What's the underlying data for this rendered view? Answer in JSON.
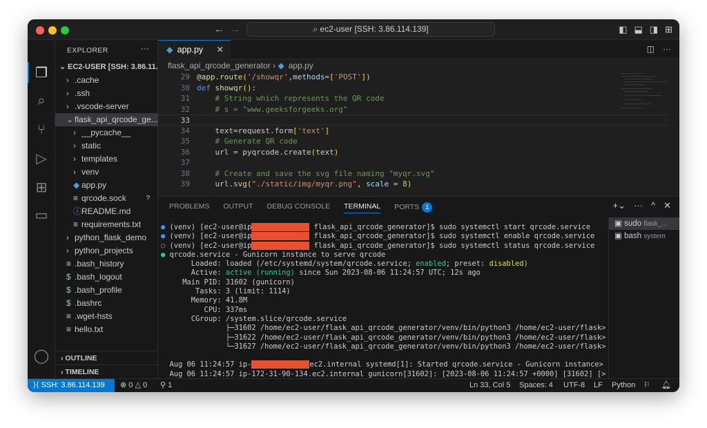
{
  "window": {
    "search": "ec2-user [SSH: 3.86.114.139]"
  },
  "explorer": {
    "title": "EXPLORER",
    "root": "EC2-USER [SSH: 3.86.11...",
    "items": [
      {
        "label": ".cache",
        "chev": "›",
        "indent": 1
      },
      {
        "label": ".ssh",
        "chev": "›",
        "indent": 1
      },
      {
        "label": ".vscode-server",
        "chev": "›",
        "indent": 1
      },
      {
        "label": "flask_api_qrcode_ge...",
        "chev": "⌄",
        "indent": 1,
        "selected": true
      },
      {
        "label": "__pycache__",
        "chev": "›",
        "indent": 2
      },
      {
        "label": "static",
        "chev": "›",
        "indent": 2
      },
      {
        "label": "templates",
        "chev": "›",
        "indent": 2
      },
      {
        "label": "venv",
        "chev": "›",
        "indent": 2
      },
      {
        "label": "app.py",
        "icon": "python",
        "indent": 2
      },
      {
        "label": "qrcode.sock",
        "icon": "file",
        "indent": 2,
        "badge": "?"
      },
      {
        "label": "README.md",
        "icon": "info",
        "indent": 2
      },
      {
        "label": "requirements.txt",
        "icon": "lines",
        "indent": 2
      },
      {
        "label": "python_flask_demo",
        "chev": "›",
        "indent": 1
      },
      {
        "label": "python_projects",
        "chev": "›",
        "indent": 1
      },
      {
        "label": ".bash_history",
        "icon": "lines",
        "indent": 1
      },
      {
        "label": ".bash_logout",
        "icon": "dollar",
        "indent": 1
      },
      {
        "label": ".bash_profile",
        "icon": "dollar",
        "indent": 1
      },
      {
        "label": ".bashrc",
        "icon": "dollar",
        "indent": 1
      },
      {
        "label": ".wget-hsts",
        "icon": "lines",
        "indent": 1
      },
      {
        "label": "hello.txt",
        "icon": "lines",
        "indent": 1
      }
    ],
    "outline": "OUTLINE",
    "timeline": "TIMELINE"
  },
  "editor": {
    "tab": "app.py",
    "breadcrumb": [
      "flask_api_qrcode_generator",
      "app.py"
    ],
    "lines": [
      {
        "n": "29",
        "tokens": [
          [
            "f",
            "@app.route"
          ],
          [
            "b",
            "("
          ],
          [
            "s",
            "'/showqr'"
          ],
          [
            "t",
            ","
          ],
          [
            "p",
            "methods"
          ],
          [
            "t",
            "="
          ],
          [
            "b",
            "["
          ],
          [
            "s",
            "'POST'"
          ],
          [
            "b",
            "])"
          ]
        ]
      },
      {
        "n": "30",
        "tokens": [
          [
            "k",
            "def "
          ],
          [
            "f",
            "showqr"
          ],
          [
            "b",
            "()"
          ],
          [
            "t",
            ":"
          ]
        ]
      },
      {
        "n": "31",
        "tokens": [
          [
            "c",
            "    # String which represents the QR code"
          ]
        ]
      },
      {
        "n": "32",
        "tokens": [
          [
            "c",
            "    # s = \"www.geeksforgeeks.org\""
          ]
        ]
      },
      {
        "n": "33",
        "tokens": [],
        "current": true
      },
      {
        "n": "34",
        "tokens": [
          [
            "t",
            "    text=request.form"
          ],
          [
            "b",
            "["
          ],
          [
            "s",
            "'text'"
          ],
          [
            "b",
            "]"
          ]
        ]
      },
      {
        "n": "35",
        "tokens": [
          [
            "c",
            "    # Generate QR code"
          ]
        ]
      },
      {
        "n": "36",
        "tokens": [
          [
            "t",
            "    url = pyqrcode.create"
          ],
          [
            "b",
            "("
          ],
          [
            "t",
            "text"
          ],
          [
            "b",
            ")"
          ]
        ]
      },
      {
        "n": "37",
        "tokens": []
      },
      {
        "n": "38",
        "tokens": [
          [
            "c",
            "    # Create and save the svg file naming \"myqr.svg\""
          ]
        ]
      },
      {
        "n": "39",
        "tokens": [
          [
            "t",
            "    url.svg"
          ],
          [
            "b",
            "("
          ],
          [
            "s",
            "\"./static/img/myqr.png\""
          ],
          [
            "t",
            ", "
          ],
          [
            "p",
            "scale"
          ],
          [
            "t",
            " = "
          ],
          [
            "n",
            "8"
          ],
          [
            "b",
            ")"
          ]
        ]
      }
    ]
  },
  "panel": {
    "tabs": [
      "PROBLEMS",
      "OUTPUT",
      "DEBUG CONSOLE",
      "TERMINAL",
      "PORTS"
    ],
    "active": "TERMINAL",
    "ports_badge": "1",
    "terminal": [
      {
        "dot": "●",
        "pre": "(venv) [ec2-user@ip",
        "redact": true,
        "post": " flask_api_qrcode_generator]$ sudo systemctl start qrcode.service"
      },
      {
        "dot": "●",
        "pre": "(venv) [ec2-user@ip",
        "redact": true,
        "post": " flask_api_qrcode_generator]$ sudo systemctl enable qrcode.service"
      },
      {
        "dot": "○",
        "pre": "(venv) [ec2-user@ip",
        "redact": true,
        "post": " flask_api_qrcode_generator]$ sudo systemctl status qrcode.service"
      },
      {
        "dot": "●",
        "green_dot": true,
        "pre": "qrcode.service - Gunicorn instance to serve qrcode"
      },
      {
        "pre": "     Loaded: loaded (/etc/systemd/system/qrcode.service; ",
        "green": "enabled",
        "mid": "; preset: ",
        "yellow": "disabled",
        "post": ")"
      },
      {
        "pre": "     Active: ",
        "green": "active (running)",
        "post": " since Sun 2023-08-06 11:24:57 UTC; 12s ago"
      },
      {
        "pre": "   Main PID: 31602 (gunicorn)"
      },
      {
        "pre": "      Tasks: 3 (limit: 1114)"
      },
      {
        "pre": "     Memory: 41.8M"
      },
      {
        "pre": "        CPU: 337ms"
      },
      {
        "pre": "     CGroup: /system.slice/qrcode.service"
      },
      {
        "pre": "             ├─31602 /home/ec2-user/flask_api_qrcode_generator/venv/bin/python3 /home/ec2-user/flask>"
      },
      {
        "pre": "             ├─31622 /home/ec2-user/flask_api_qrcode_generator/venv/bin/python3 /home/ec2-user/flask>"
      },
      {
        "pre": "             └─31627 /home/ec2-user/flask_api_qrcode_generator/venv/bin/python3 /home/ec2-user/flask>"
      },
      {
        "pre": ""
      },
      {
        "pre": "Aug 06 11:24:57 ip-",
        "redact": true,
        "post": "ec2.internal systemd[1]: Started qrcode.service - Gunicorn instance>"
      },
      {
        "pre": "Aug 06 11:24:57 ip-172-31-90-134.ec2.internal gunicorn[31602]: [2023-08-06 11:24:57 +0000] [31602] [>"
      }
    ],
    "terminals": [
      {
        "name": "sudo",
        "detail": "flask_..."
      },
      {
        "name": "bash",
        "detail": "system"
      }
    ]
  },
  "status": {
    "remote": "SSH: 3.86.114.139",
    "errors": "0",
    "warnings": "0",
    "ports": "1",
    "position": "Ln 33, Col 5",
    "spaces": "Spaces: 4",
    "encoding": "UTF-8",
    "eol": "LF",
    "language": "Python"
  },
  "colors": {
    "accent": "#0078d4",
    "redaction": "#e8502f"
  }
}
